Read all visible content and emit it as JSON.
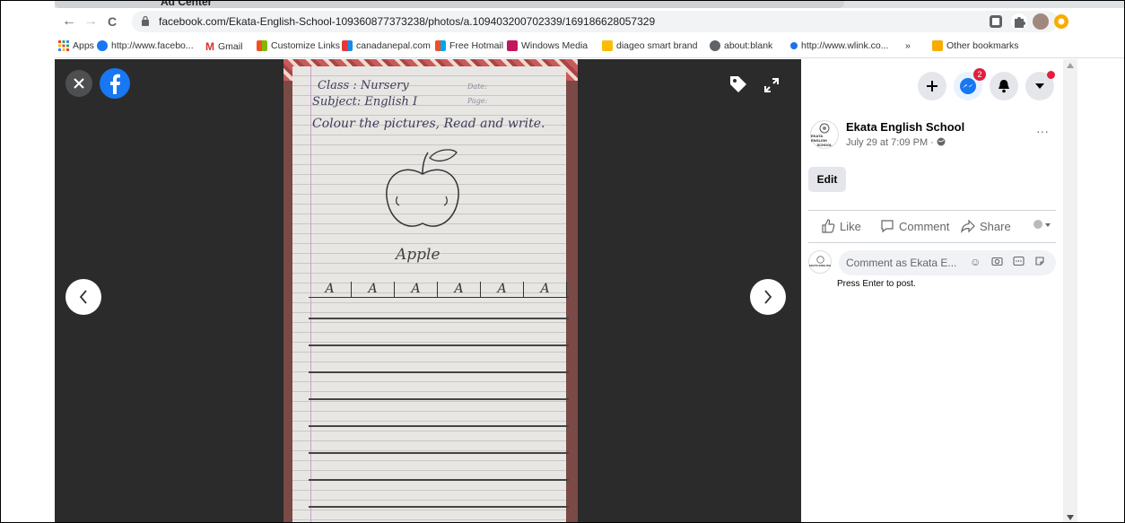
{
  "browser": {
    "tab_title": "Ad Center",
    "url": "facebook.com/Ekata-English-School-109360877373238/photos/a.109403200702339/169186628057329",
    "nav": {
      "back": "←",
      "forward": "→",
      "reload": "C"
    },
    "bookmarks": [
      {
        "label": "Apps",
        "icon_color": "#ea4335"
      },
      {
        "label": "http://www.facebo...",
        "icon_color": "#1877f2"
      },
      {
        "label": "Gmail",
        "icon_color": "#d93025"
      },
      {
        "label": "Customize Links",
        "icon_color": "#f4b400"
      },
      {
        "label": "canadanepal.com",
        "icon_color": "#4285f4"
      },
      {
        "label": "Free Hotmail",
        "icon_color": "#f25022"
      },
      {
        "label": "Windows Media",
        "icon_color": "#c2185b"
      },
      {
        "label": "diageo smart brand",
        "icon_color": "#fbbc05"
      },
      {
        "label": "about:blank",
        "icon_color": "#5f6368"
      },
      {
        "label": "http://www.wlink.co...",
        "icon_color": "#1a73e8"
      }
    ],
    "bookmarks_overflow": "»",
    "other_bookmarks": "Other bookmarks"
  },
  "viewer": {
    "photo_text": {
      "class_line": "Class : Nursery",
      "subject_line": "Subject: English I",
      "instruction": "Colour the pictures, Read and write.",
      "date_label": "Date:",
      "page_label": "Page:",
      "word": "Apple",
      "letters": [
        "A",
        "A",
        "A",
        "A",
        "A",
        "A"
      ]
    }
  },
  "panel": {
    "messenger_badge": "2",
    "page_name": "Ekata English School",
    "logo_text_1": "EKATA ENGLISH",
    "logo_text_2": "SCHOOL",
    "post_time": "July 29 at 7:09 PM · ",
    "more": "···",
    "edit_label": "Edit",
    "like_label": "Like",
    "comment_label": "Comment",
    "share_label": "Share",
    "comment_placeholder": "Comment as Ekata E...",
    "press_enter": "Press Enter to post."
  },
  "colors": {
    "fb_blue": "#1877f2",
    "viewer_bg": "#2b2b2b",
    "notification_red": "#e41e3f"
  }
}
